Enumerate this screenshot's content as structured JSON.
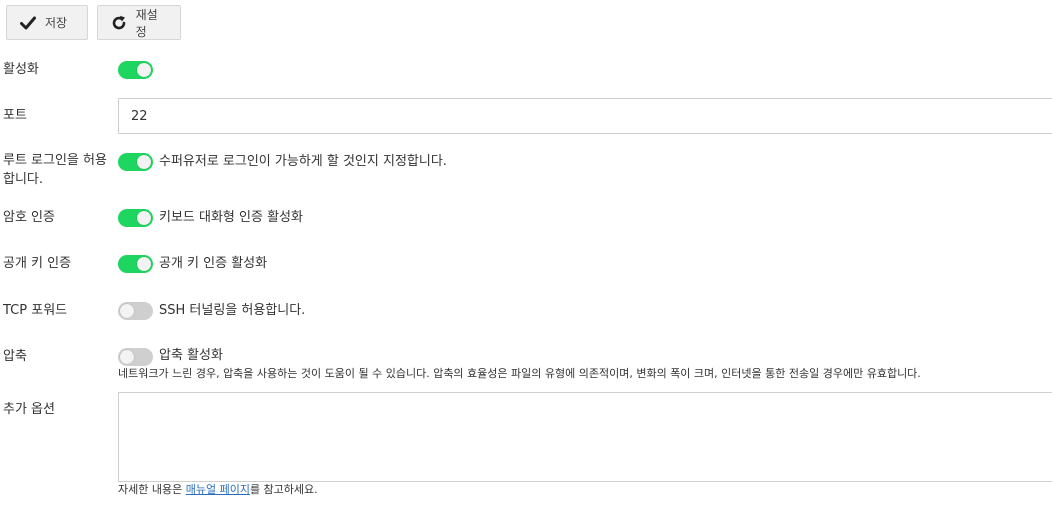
{
  "toolbar": {
    "save_label": "저장",
    "reset_label": "재설정"
  },
  "form": {
    "enable": {
      "label": "활성화",
      "on": true
    },
    "port": {
      "label": "포트",
      "value": "22"
    },
    "root_login": {
      "label_line1": "루트 로그인을 허용",
      "label_line2": "합니다.",
      "on": true,
      "description": "수퍼유저로 로그인이 가능하게 할 것인지 지정합니다."
    },
    "password_auth": {
      "label": "암호 인증",
      "on": true,
      "description": "키보드 대화형 인증 활성화"
    },
    "pubkey_auth": {
      "label": "공개 키 인증",
      "on": true,
      "description": "공개 키 인증 활성화"
    },
    "tcp_forwarding": {
      "label": "TCP 포워드",
      "on": false,
      "description": "SSH 터널링을 허용합니다."
    },
    "compression": {
      "label": "압축",
      "on": false,
      "description": "압축 활성화",
      "help": "네트워크가 느린 경우, 압축을 사용하는 것이 도움이 될 수 있습니다. 압축의 효율성은 파일의 유형에 의존적이며, 변화의 폭이 크며, 인터넷을 통한 전송일 경우에만 유효합니다."
    },
    "extra_options": {
      "label": "추가 옵션",
      "value": "",
      "help_before": "자세한 내용은 ",
      "help_link": "매뉴얼 페이지",
      "help_after": "를 참고하세요."
    }
  },
  "colors": {
    "toggle_on": "#1ed65f",
    "toggle_off": "#cfcfcf",
    "link": "#2a6ebb"
  },
  "icons": {
    "save": "checkmark-icon",
    "reset": "refresh-icon"
  }
}
